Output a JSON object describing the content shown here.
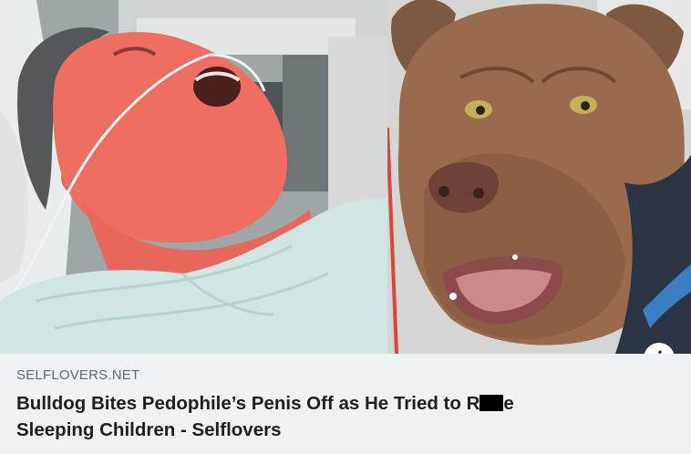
{
  "ad": {
    "source": "SELFLOVERS.NET",
    "headline_part1": "Bulldog Bites Pedophile’s Penis Off as He Tried to R",
    "headline_part2": "e",
    "headline_line2": "Sleeping Children - Selflovers",
    "info_icon": "i"
  },
  "images": {
    "left": "photo-man-in-hospital-bed",
    "right": "photo-brown-pit-bull"
  },
  "colors": {
    "caption_bg": "#eef2f5",
    "headline": "#1f1f1f",
    "source": "#5e6a73"
  }
}
